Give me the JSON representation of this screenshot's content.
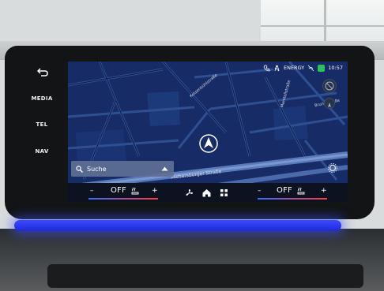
{
  "hardkeys": {
    "back": "back-arrow",
    "media": "MEDIA",
    "tel": "TEL",
    "nav": "NAV"
  },
  "status": {
    "drive_mode": "ENERGY",
    "time": "10:57"
  },
  "map": {
    "streets": {
      "top_diag": "Kotzenbühlstraße",
      "right_vert": "Marstallstraße",
      "right_label": "Brundlstraße",
      "main": "Mattersburger Straße"
    }
  },
  "search": {
    "label": "Suche"
  },
  "climate": {
    "left": {
      "minus": "–",
      "value": "OFF",
      "plus": "+"
    },
    "right": {
      "minus": "–",
      "value": "OFF",
      "plus": "+"
    }
  },
  "colors": {
    "map_bg": "#152a63",
    "ambient_light": "#2b3bff",
    "energy_green": "#27c25a"
  }
}
